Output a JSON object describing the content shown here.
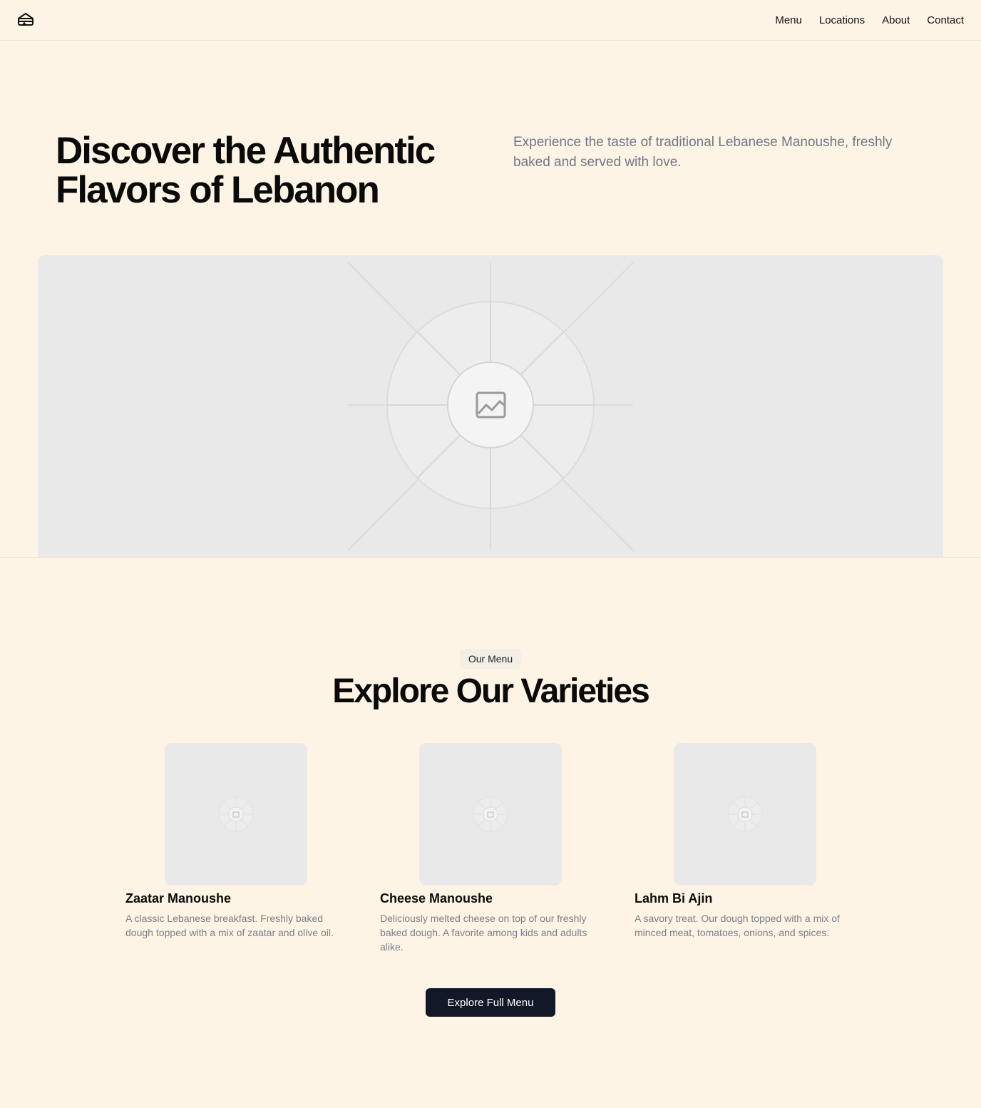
{
  "header": {
    "logo_icon": "manoushe-logo-icon",
    "nav": [
      {
        "label": "Menu"
      },
      {
        "label": "Locations"
      },
      {
        "label": "About"
      },
      {
        "label": "Contact"
      }
    ]
  },
  "hero": {
    "title": "Discover the Authentic Flavors of Lebanon",
    "subtitle": "Experience the taste of traditional Lebanese Manoushe, freshly baked and served with love.",
    "image_icon": "image-placeholder-icon"
  },
  "menu": {
    "badge": "Our Menu",
    "title": "Explore Our Varieties",
    "items": [
      {
        "name": "Zaatar Manoushe",
        "description": "A classic Lebanese breakfast. Freshly baked dough topped with a mix of zaatar and olive oil."
      },
      {
        "name": "Cheese Manoushe",
        "description": "Deliciously melted cheese on top of our freshly baked dough. A favorite among kids and adults alike."
      },
      {
        "name": "Lahm Bi Ajin",
        "description": "A savory treat. Our dough topped with a mix of minced meat, tomatoes, onions, and spices."
      }
    ],
    "cta_label": "Explore Full Menu"
  },
  "colors": {
    "background": "#fdf4e5",
    "placeholder": "#e9e9e9",
    "button": "#111827",
    "muted_text": "#6f7785"
  }
}
